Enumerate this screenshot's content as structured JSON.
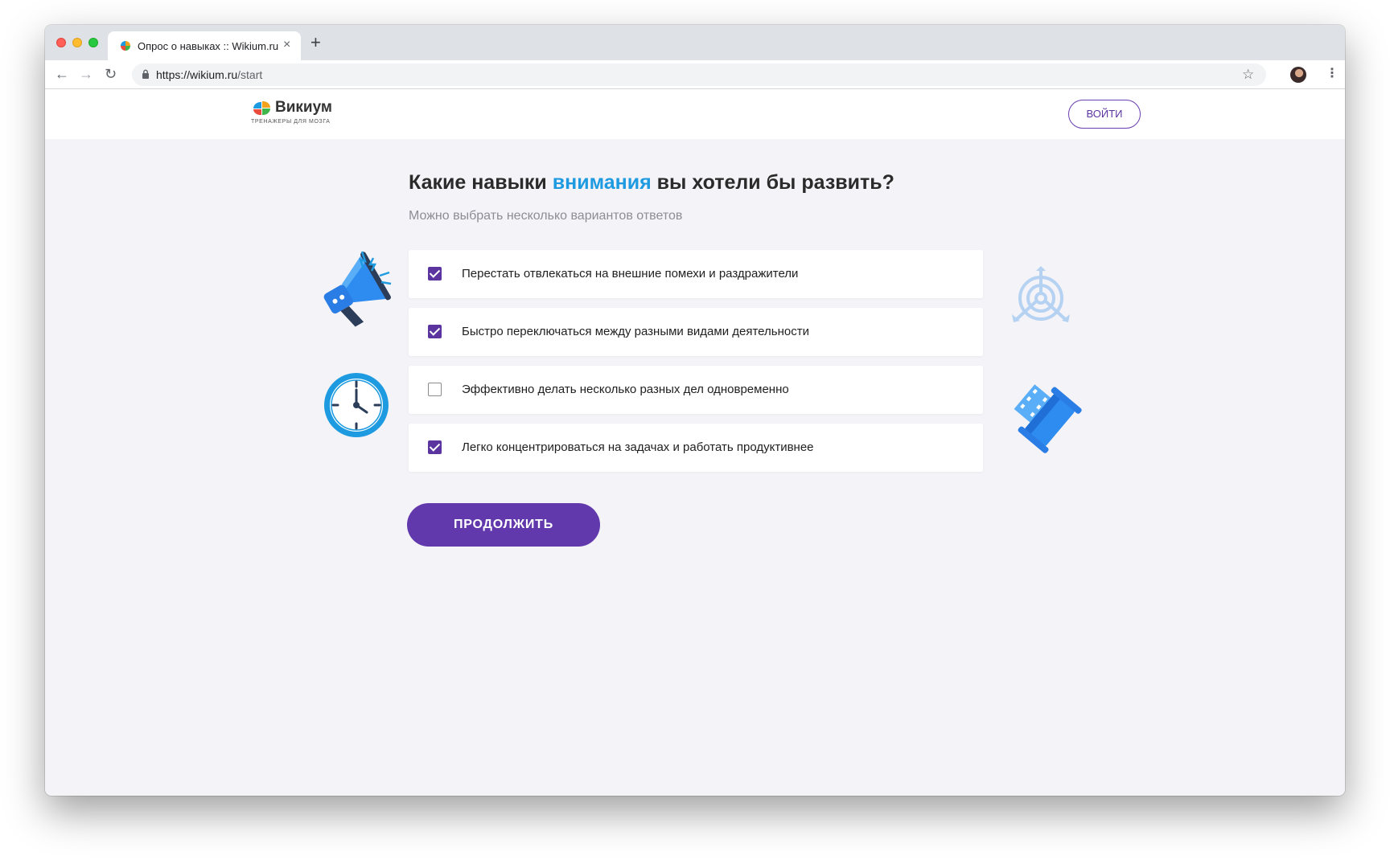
{
  "browser": {
    "tab_title": "Опрос о навыках :: Wikium.ru",
    "new_tab_symbol": "+",
    "close_symbol": "×",
    "url_host": "https://wikium.ru",
    "url_path": "/start",
    "back_symbol": "←",
    "forward_symbol": "→",
    "reload_symbol": "↻",
    "star_symbol": "☆",
    "menu_symbol": "⋮"
  },
  "header": {
    "logo_name": "Викиум",
    "logo_tagline": "ТРЕНАЖЕРЫ ДЛЯ МОЗГА",
    "login_label": "ВОЙТИ"
  },
  "question": {
    "title_before": "Какие навыки ",
    "title_highlight": "внимания",
    "title_after": " вы хотели бы развить?",
    "hint": "Можно выбрать несколько вариантов ответов"
  },
  "options": [
    {
      "label": "Перестать отвлекаться на внешние помехи и раздражители",
      "checked": true
    },
    {
      "label": "Быстро переключаться между разными видами деятельности",
      "checked": true
    },
    {
      "label": "Эффективно делать несколько разных дел одновременно",
      "checked": false
    },
    {
      "label": "Легко концентрироваться на задачах и работать продуктивнее",
      "checked": true
    }
  ],
  "continue_label": "ПРОДОЛЖИТЬ",
  "illustrations": [
    "megaphone-icon",
    "target-icon",
    "clock-icon",
    "film-roll-icon"
  ],
  "colors": {
    "accent": "#6239ac",
    "highlight": "#1e9be0",
    "page_bg": "#f4f3f8"
  }
}
